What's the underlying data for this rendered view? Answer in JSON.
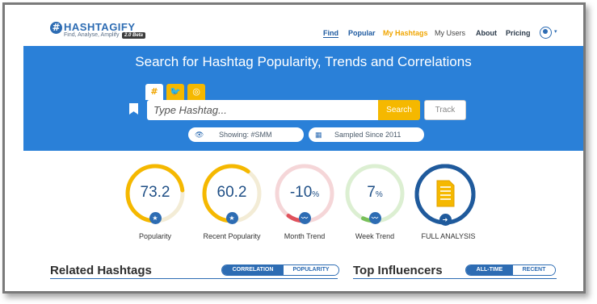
{
  "header": {
    "logo_mark": "#",
    "logo_name": "HASHTAGIFY",
    "logo_tagline": "Find, Analyse, Amplify",
    "beta": "2.0 Beta",
    "nav": [
      {
        "label": "Find"
      },
      {
        "label": "Popular"
      },
      {
        "label": "My Hashtags"
      },
      {
        "label": "My Users"
      },
      {
        "label": "About"
      },
      {
        "label": "Pricing"
      }
    ],
    "user_caret": "▾"
  },
  "hero": {
    "title": "Search for Hashtag Popularity, Trends and Correlations",
    "tabs": [
      {
        "label": "#"
      },
      {
        "label": "🐦"
      },
      {
        "label": "◎"
      }
    ],
    "search_placeholder": "Type Hashtag...",
    "search_button": "Search",
    "track_button": "Track",
    "showing_icon": "👁",
    "showing": "Showing: #SMM",
    "sampled_icon": "▦",
    "sampled": "Sampled Since 2011"
  },
  "metrics": [
    {
      "value": "73.2",
      "suffix": "",
      "label": "Popularity",
      "fraction": 0.73,
      "color": "#f5b800",
      "track": "#f3ecd6",
      "badge": "★",
      "badge_color": "#2d6cb3"
    },
    {
      "value": "60.2",
      "suffix": "",
      "label": "Recent Popularity",
      "fraction": 0.6,
      "color": "#f5b800",
      "track": "#f3ecd6",
      "badge": "★",
      "badge_color": "#2d6cb3"
    },
    {
      "value": "-10",
      "suffix": "%",
      "label": "Month Trend",
      "fraction": 0.1,
      "color": "#e0525c",
      "track": "#f5d6d8",
      "badge": "〰",
      "badge_color": "#2d6cb3"
    },
    {
      "value": "7",
      "suffix": "%",
      "label": "Week Trend",
      "fraction": 0.07,
      "color": "#79c05a",
      "track": "#dcefd2",
      "badge": "〰",
      "badge_color": "#2d6cb3"
    },
    {
      "value": "",
      "suffix": "",
      "label": "FULL ANALYSIS",
      "fraction": 1.0,
      "color": "#1f5a9c",
      "track": "#1f5a9c",
      "badge": "➜",
      "badge_color": "#1f5a9c"
    }
  ],
  "sections": {
    "related": {
      "title": "Related Hashtags",
      "toggle": [
        "CORRELATION",
        "POPULARITY"
      ]
    },
    "influencers": {
      "title": "Top Influencers",
      "toggle": [
        "ALL-TIME",
        "RECENT"
      ]
    }
  }
}
